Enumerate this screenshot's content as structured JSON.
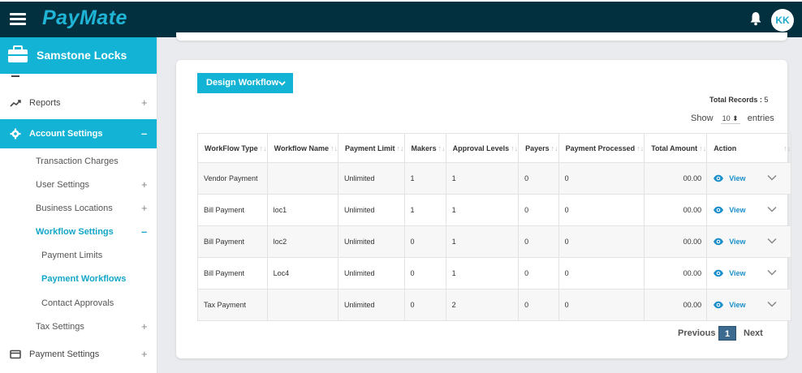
{
  "app": {
    "logo": "PayMate",
    "avatar_initials": "KK"
  },
  "sidebar": {
    "org_name": "Samstone Locks",
    "items": [
      {
        "label": "Reports",
        "toggle": "+"
      },
      {
        "label": "Account Settings",
        "toggle": "–"
      },
      {
        "label": "Transaction Charges",
        "toggle": ""
      },
      {
        "label": "User Settings",
        "toggle": "+"
      },
      {
        "label": "Business Locations",
        "toggle": "+"
      },
      {
        "label": "Workflow Settings",
        "toggle": "–"
      },
      {
        "label": "Payment Limits",
        "toggle": ""
      },
      {
        "label": "Payment Workflows",
        "toggle": ""
      },
      {
        "label": "Contact Approvals",
        "toggle": ""
      },
      {
        "label": "Tax Settings",
        "toggle": "+"
      },
      {
        "label": "Payment Settings",
        "toggle": "+"
      }
    ]
  },
  "main": {
    "design_button": "Design Workflow",
    "total_label": "Total Records :",
    "total_value": "5",
    "show_label": "Show",
    "show_value": "10",
    "entries_label": "entries",
    "columns": [
      "WorkFlow Type",
      "Workflow Name",
      "Payment Limit",
      "Makers",
      "Approval Levels",
      "Payers",
      "Payment Processed",
      "Total Amount",
      "Action"
    ],
    "rows": [
      {
        "type": "Vendor Payment",
        "name": "",
        "limit": "Unlimited",
        "makers": "1",
        "levels": "1",
        "payers": "0",
        "processed": "0",
        "amount": "00.00",
        "action": "View"
      },
      {
        "type": "Bill Payment",
        "name": "loc1",
        "limit": "Unlimited",
        "makers": "1",
        "levels": "1",
        "payers": "0",
        "processed": "0",
        "amount": "00.00",
        "action": "View"
      },
      {
        "type": "Bill Payment",
        "name": "loc2",
        "limit": "Unlimited",
        "makers": "0",
        "levels": "1",
        "payers": "0",
        "processed": "0",
        "amount": "00.00",
        "action": "View"
      },
      {
        "type": "Bill Payment",
        "name": "Loc4",
        "limit": "Unlimited",
        "makers": "0",
        "levels": "1",
        "payers": "0",
        "processed": "0",
        "amount": "00.00",
        "action": "View"
      },
      {
        "type": "Tax Payment",
        "name": "",
        "limit": "Unlimited",
        "makers": "0",
        "levels": "2",
        "payers": "0",
        "processed": "0",
        "amount": "00.00",
        "action": "View"
      }
    ],
    "pagination": {
      "prev": "Previous",
      "current": "1",
      "next": "Next"
    }
  },
  "colors": {
    "topbar": "#03303f",
    "accent": "#12b3d4",
    "link": "#1a8fc9",
    "page_active": "#3d6b8f"
  }
}
